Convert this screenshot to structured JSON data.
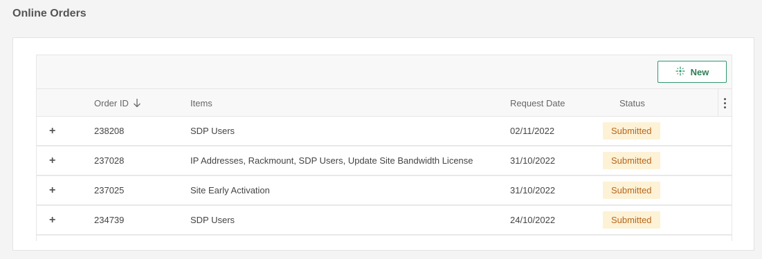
{
  "page": {
    "title": "Online Orders"
  },
  "toolbar": {
    "new_label": "New",
    "new_icon": "sparkle-icon"
  },
  "columns": {
    "order_id": "Order ID",
    "items": "Items",
    "request_date": "Request Date",
    "status": "Status",
    "sort_icon": "arrow-down-icon"
  },
  "rows": [
    {
      "expand": "+",
      "order_id": "238208",
      "items": "SDP Users",
      "request_date": "02/11/2022",
      "status": "Submitted"
    },
    {
      "expand": "+",
      "order_id": "237028",
      "items": "IP Addresses, Rackmount, SDP Users, Update Site Bandwidth License",
      "request_date": "31/10/2022",
      "status": "Submitted"
    },
    {
      "expand": "+",
      "order_id": "237025",
      "items": "Site Early Activation",
      "request_date": "31/10/2022",
      "status": "Submitted"
    },
    {
      "expand": "+",
      "order_id": "234739",
      "items": "SDP Users",
      "request_date": "24/10/2022",
      "status": "Submitted"
    }
  ],
  "colors": {
    "accent": "#2e9a6b",
    "status_bg": "#fdf1d6",
    "status_text": "#b8661a"
  }
}
